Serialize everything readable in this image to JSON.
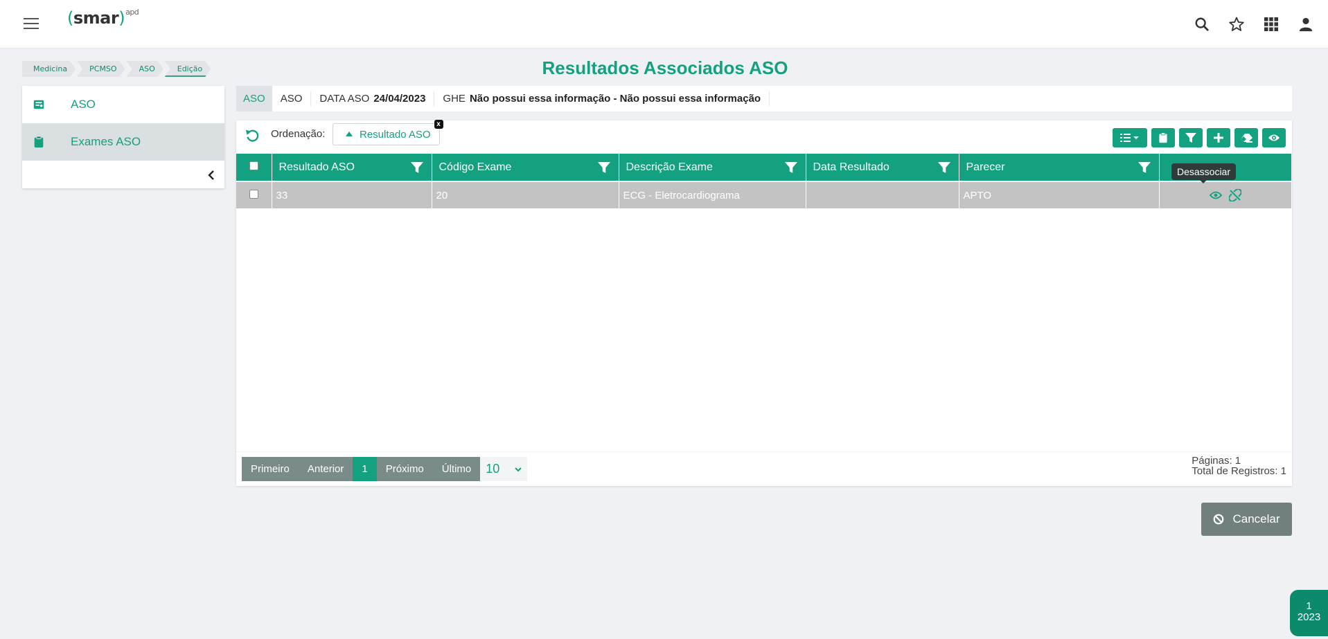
{
  "header": {
    "logo_text": "smar",
    "logo_suffix": "apd",
    "logo_paren_open": "(",
    "logo_paren_close": ")"
  },
  "breadcrumb": [
    "Medicina",
    "PCMSO",
    "ASO",
    "Edição"
  ],
  "page_title": "Resultados Associados ASO",
  "sidebar": {
    "items": [
      {
        "label": "ASO",
        "icon": "aso-icon"
      },
      {
        "label": "Exames ASO",
        "icon": "clipboard-icon"
      }
    ]
  },
  "infobar": {
    "tab": "ASO",
    "aso_label": "ASO",
    "data_label": "DATA ASO",
    "data_value": "24/04/2023",
    "ghe_label": "GHE",
    "ghe_value": "Não possui essa informação - Não possui essa informação"
  },
  "ordering": {
    "label": "Ordenação:",
    "chip": "Resultado ASO",
    "chip_close": "x"
  },
  "table": {
    "headers": [
      "Resultado ASO",
      "Código Exame",
      "Descrição Exame",
      "Data Resultado",
      "Parecer"
    ],
    "rows": [
      {
        "resultado": "33",
        "codigo": "20",
        "descricao": "ECG - Eletrocardiograma",
        "data": "",
        "parecer": "APTO"
      }
    ]
  },
  "tooltip": "Desassociar",
  "pager": {
    "first": "Primeiro",
    "prev": "Anterior",
    "current": "1",
    "next": "Próximo",
    "last": "Último",
    "page_size": "10",
    "pages_text": "Páginas: 1",
    "total_text": "Total de Registros: 1"
  },
  "cancel_label": "Cancelar",
  "badge": {
    "line1": "1",
    "line2": "2023"
  },
  "colors": {
    "accent": "#13a17f",
    "row_bg": "#c3c3c3",
    "pager_bg": "#7a8c8a"
  }
}
